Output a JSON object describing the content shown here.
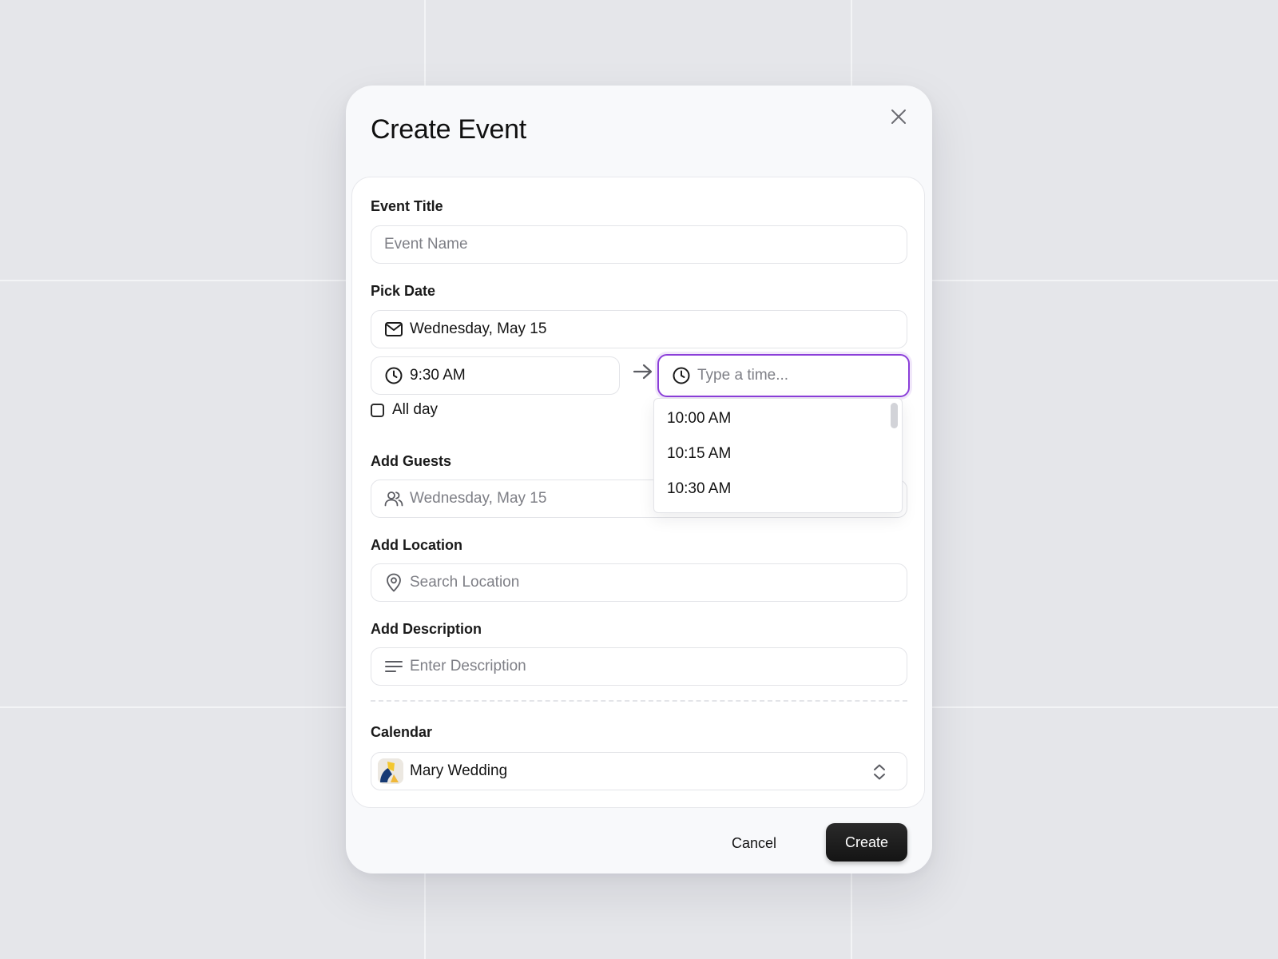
{
  "modal": {
    "title": "Create Event",
    "close_icon": "close-icon"
  },
  "fields": {
    "event_title": {
      "label": "Event Title",
      "placeholder": "Event Name"
    },
    "pick_date": {
      "label": "Pick Date",
      "date_value": "Wednesday, May 15",
      "date_icon": "mail-icon",
      "start_time": "9:30 AM",
      "time_icon": "clock-icon",
      "arrow_icon": "arrow-right-icon",
      "end_time_placeholder": "Type a time...",
      "all_day_label": "All day",
      "all_day_checked": false,
      "time_options": [
        "10:00 AM",
        "10:15 AM",
        "10:30 AM"
      ]
    },
    "guests": {
      "label": "Add Guests",
      "placeholder": "Wednesday, May 15",
      "icon": "users-icon"
    },
    "location": {
      "label": "Add Location",
      "placeholder": "Search Location",
      "icon": "location-pin-icon"
    },
    "description": {
      "label": "Add Description",
      "placeholder": "Enter Description",
      "icon": "text-align-icon"
    },
    "calendar": {
      "label": "Calendar",
      "value": "Mary Wedding",
      "icon": "chevron-up-down-icon"
    }
  },
  "footer": {
    "cancel_label": "Cancel",
    "create_label": "Create"
  },
  "colors": {
    "background": "#e5e6ea",
    "focus_ring": "#8b3fd9",
    "primary_button": "#1a1a1a",
    "placeholder_text": "#7e7f86"
  }
}
